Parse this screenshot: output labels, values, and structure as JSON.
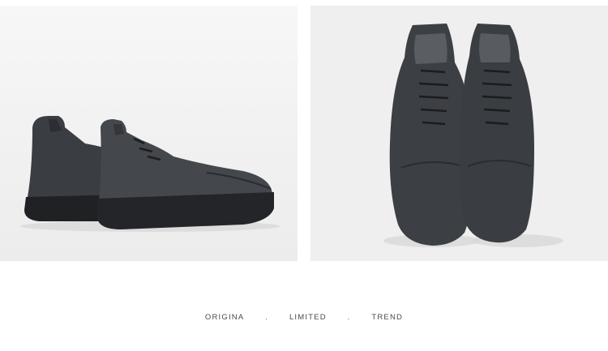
{
  "tagline": {
    "word1": "ORIGINA",
    "sep1": ".",
    "word2": "LIMITED",
    "sep2": ".",
    "word3": "TREND"
  }
}
